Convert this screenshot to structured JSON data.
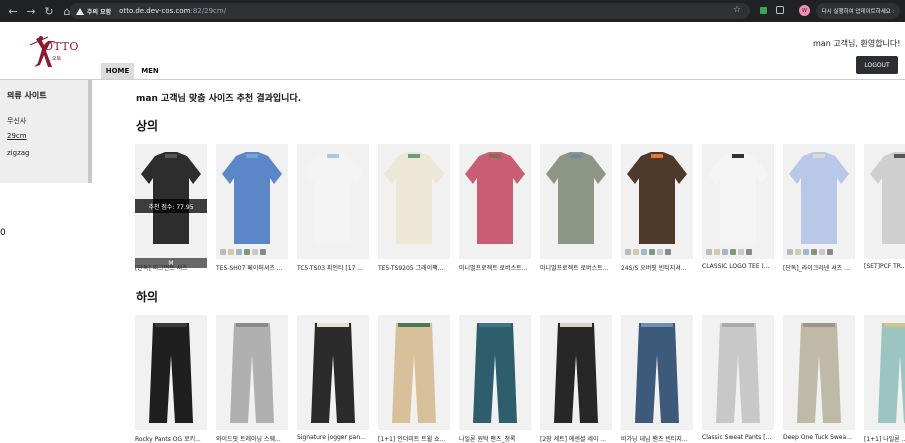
{
  "browser": {
    "warning": "주의 요함",
    "url_host": "otto.de.dev-cos.com",
    "url_path": ":82/29cm/",
    "relaunch": "다시 실행하여 업데이트하세요 :",
    "profile": "W"
  },
  "site": {
    "logo_text": "OTTO",
    "logo_sub": "오토",
    "welcome": "man 고객님, 환영합니다!",
    "logout_label": "LOGOUT",
    "nav": [
      {
        "label": "HOME"
      },
      {
        "label": "MEN"
      }
    ],
    "stray_char": "0"
  },
  "sidebar": {
    "title": "의류 사이트",
    "items": [
      {
        "label": "무신사"
      },
      {
        "label": "29cm"
      },
      {
        "label": "zigzag"
      }
    ]
  },
  "main": {
    "title": "man 고객님 맞춤 사이즈 추천 결과입니다.",
    "score_overlay": "추천 점수: 77.95",
    "size_overlay": "M",
    "categories": [
      {
        "title": "상의",
        "products": [
          {
            "caption": "[단독] 피그먼트 셔츠",
            "color": "#2d2d2d",
            "accent": "#555"
          },
          {
            "caption": "TE5-SH07 페이퍼셔츠 ...",
            "color": "#5b86c8",
            "accent": "#7ba0d8"
          },
          {
            "caption": "TC5-TS03 피인티 [17 ...",
            "color": "#f3f3f3",
            "accent": "#a8c9e0"
          },
          {
            "caption": "TE5-TS9205 그래이팩...",
            "color": "#ece7d6",
            "accent": "#6b9b7a"
          },
          {
            "caption": "미니멀프로젝트 로버스트...",
            "color": "#c85d73",
            "accent": "#8b6a52"
          },
          {
            "caption": "미니멀프로젝트 로버스트...",
            "color": "#8d9584",
            "accent": "#6e8aa6"
          },
          {
            "caption": "24S/S 오버핏 빈티지셔...",
            "color": "#4d3a2b",
            "accent": "#e07a3a"
          },
          {
            "caption": "CLASSIC LOGO TEE (...",
            "color": "#f5f5f5",
            "accent": "#333"
          },
          {
            "caption": "[단독]_라이크라넨 셔츠 ...",
            "color": "#b8c8e6",
            "accent": "#d9d9d9"
          },
          {
            "caption": "[SET]PCF TR...",
            "color": "#cfcfcf",
            "accent": "#555"
          }
        ]
      },
      {
        "title": "하의",
        "products": [
          {
            "caption": "Rocky Pants OG 로키...",
            "color": "#1f1f1f",
            "accent": "#3a3a3a"
          },
          {
            "caption": "와이드핏 트레이닝 스웨...",
            "color": "#b0b0b0",
            "accent": "#8a8a8a"
          },
          {
            "caption": "Signature jogger pan...",
            "color": "#2b2b2b",
            "accent": "#e6e0cc"
          },
          {
            "caption": "[1+1] 언더미트 트윌 쇼...",
            "color": "#d8c09a",
            "accent": "#4a7a5a"
          },
          {
            "caption": "나일론 원턱 팬츠_청록",
            "color": "#2e5d6b",
            "accent": "#3f7582"
          },
          {
            "caption": "[2장 세트] 에센셜 세이 ...",
            "color": "#272727",
            "accent": "#d6d2c6"
          },
          {
            "caption": "비가닝 데님 팬츠 빈티지...",
            "color": "#3e5a7a",
            "accent": "#6d8fb2"
          },
          {
            "caption": "Classic Sweat Pants [...",
            "color": "#c8c8c8",
            "accent": "#aaa"
          },
          {
            "caption": "Deep One Tuck Swea...",
            "color": "#bfb9a8",
            "accent": "#9c9686"
          },
          {
            "caption": "[1+1] 나일론 ...",
            "color": "#9cc4c0",
            "accent": "#d4c58a"
          }
        ]
      }
    ]
  },
  "colors": {
    "logo": "#8b1a2a",
    "logout_bg": "#2b2e33",
    "chrome_bg": "#202124"
  }
}
